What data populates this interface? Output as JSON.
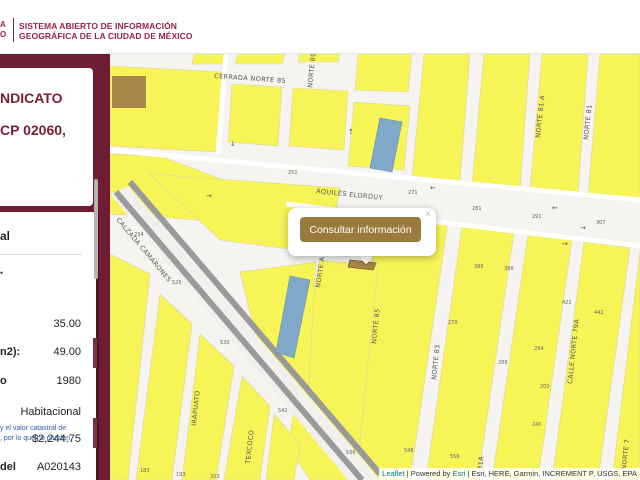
{
  "header": {
    "cut_text": [
      "A",
      "O"
    ],
    "title_line1": "SISTEMA ABIERTO DE INFORMACIÓN",
    "title_line2": "GEOGRÁFICA DE LA CIUDAD DE MÉXICO"
  },
  "sidebar": {
    "card_title_line1": "NDICATO",
    "card_title_line2": "CP 02060,",
    "section_title": "al",
    "bullet": "•",
    "rows": [
      {
        "key": "",
        "value": "35.00"
      },
      {
        "key": "n2):",
        "value": "49.00"
      },
      {
        "key": "o",
        "value": "1980"
      },
      {
        "key": "",
        "value": "Habitacional"
      },
      {
        "key": "",
        "value": "$2,244.75"
      },
      {
        "key": "del",
        "value": "A020143"
      }
    ],
    "note_line1": "y el valor catastral de",
    "note_line2": ", por lo que no pueden"
  },
  "map": {
    "streets": {
      "cerrada_norte": "CERRADA NORTE 85",
      "norte_89": "NORTE 89",
      "norte_81a": "NORTE 81 A",
      "norte_81": "NORTE 81",
      "aquiles": "AQUILES ELORDUY",
      "calzada": "CALZADA CAMARONES",
      "norte_a": "NORTE A",
      "norte_85": "NORTE 85",
      "norte_83": "NORTE 83",
      "norte_79a": "CALLE NORTE 79A",
      "irapuato": "IRAPUATO",
      "texcoco": "TEXCOCO",
      "norte_81a_b": "81A",
      "norte_79": "NORTE 7"
    },
    "numbers": [
      "251",
      "271",
      "281",
      "291",
      "307",
      "234",
      "526",
      "530",
      "542",
      "536",
      "183",
      "193",
      "203",
      "396",
      "388",
      "422",
      "442",
      "294",
      "288",
      "200",
      "270",
      "240",
      "548",
      "556"
    ],
    "popup": {
      "button_label": "Consultar información",
      "close_label": "×"
    },
    "attribution": {
      "leaflet": "Leaflet",
      "powered": " | Powered by ",
      "esri": "Esri",
      "rest": " | Esri, HERE, Garmin, INCREMENT P, USGS, EPA"
    },
    "colors": {
      "block": "#f7f457",
      "road": "#f6f4f0",
      "water": "#7fa8c9",
      "brown": "#a98649",
      "accent": "#9b2247"
    }
  }
}
